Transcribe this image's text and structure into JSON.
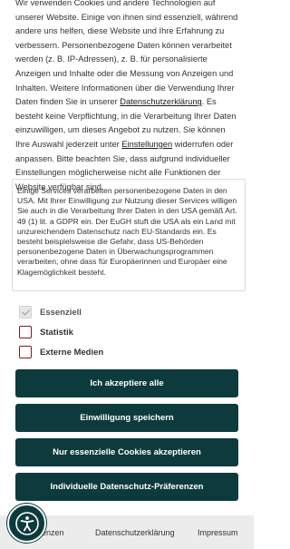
{
  "intro": {
    "text_1": "Wir verwenden Cookies und andere Technologien auf unserer Website. Einige von ihnen sind essenziell, während andere uns helfen, diese Website und Ihre Erfahrung zu verbessern. Personenbezogene Daten können verarbeitet werden (z. B. IP-Adressen), z. B. für personalisierte Anzeigen und Inhalte oder die Messung von Anzeigen und Inhalten. Weitere Informationen über die Verwendung Ihrer Daten finden Sie in unserer ",
    "privacy_link": "Datenschutzerklärung",
    "text_2": ". Es besteht keine Verpflichtung, in die Verarbeitung Ihrer Daten einzuwilligen, um dieses Angebot zu nutzen. Sie können Ihre Auswahl jederzeit unter ",
    "settings_link": "Einstellungen",
    "text_3": " widerrufen oder anpassen. Bitte beachten Sie, dass aufgrund individueller Einstellungen möglicherweise nicht alle Funktionen der Website verfügbar sind."
  },
  "usa_notice": "Einige Services verarbeiten personenbezogene Daten in den USA. Mit Ihrer Einwilligung zur Nutzung dieser Services willigen Sie auch in die Verarbeitung Ihrer Daten in den USA gemäß Art. 49 (1) lit. a GDPR ein. Der EuGH stuft die USA als ein Land mit unzureichendem Datenschutz nach EU-Standards ein. Es besteht beispielsweise die Gefahr, dass US-Behörden personenbezogene Daten in Überwachungsprogrammen verarbeiten, ohne dass für Europäerinnen und Europäer eine Klagemöglichkeit besteht.",
  "checkboxes": [
    {
      "label": "Essenziell",
      "checked": true,
      "disabled": true
    },
    {
      "label": "Statistik",
      "checked": false,
      "disabled": false
    },
    {
      "label": "Externe Medien",
      "checked": false,
      "disabled": false
    }
  ],
  "buttons": {
    "accept_all": "Ich akzeptiere alle",
    "save_consent": "Einwilligung speichern",
    "essential_only": "Nur essenzielle Cookies akzeptieren",
    "individual": "Individuelle Datenschutz-Präferenzen"
  },
  "footer": {
    "link_1_partial": "enzen",
    "link_2": "Datenschutzerklärung",
    "link_3": "Impressum"
  },
  "colors": {
    "button_bg": "#0d3b3d",
    "checkbox_border": "#7b1f1f",
    "footer_bg": "#ececec"
  },
  "icons": {
    "accessibility": "accessibility-person-icon",
    "checkmark": "checkmark-icon"
  }
}
